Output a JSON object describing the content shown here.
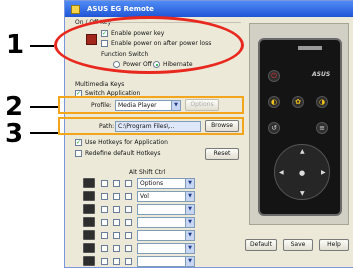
{
  "callouts": [
    "1",
    "2",
    "3"
  ],
  "window": {
    "title": "ASUS EG Remote"
  },
  "onoff": {
    "group_label": "On / Off Key",
    "enable_power_key": "Enable power key",
    "enable_power_on_after_power_loss": "Enable power on after power loss",
    "function_switch_label": "Function Switch",
    "power_off_label": "Power Off",
    "hibernate_label": "Hibernate"
  },
  "multimedia": {
    "group_label": "Multimedia Keys",
    "switch_application_label": "Switch Application",
    "profile_label": "Profile:",
    "profile_value": "Media Player",
    "profile_button": "Options",
    "path_label": "Path:",
    "path_value": "C:\\Program Files\\...",
    "browse_button": "Browse"
  },
  "hotkeys": {
    "use_hotkeys_label": "Use Hotkeys for Application",
    "redefine_label": "Redefine default Hotkeys",
    "reset_button": "Reset",
    "table_header": "Alt Shift Ctrl",
    "rows": [
      {
        "key": "Esc",
        "value": "Options"
      },
      {
        "key": "Tab",
        "value": "Vol"
      },
      {
        "key": "Up",
        "value": ""
      },
      {
        "key": "Down",
        "value": ""
      },
      {
        "key": "Left",
        "value": ""
      },
      {
        "key": "Right",
        "value": ""
      },
      {
        "key": "Enter",
        "value": ""
      }
    ]
  },
  "remote": {
    "brand": "ASUS"
  },
  "buttons": {
    "default": "Default",
    "save": "Save",
    "help": "Help"
  },
  "colors": {
    "callout_ellipse": "#e8281e",
    "callout_box": "#f3a51c",
    "titlebar": "#1f55d6"
  }
}
